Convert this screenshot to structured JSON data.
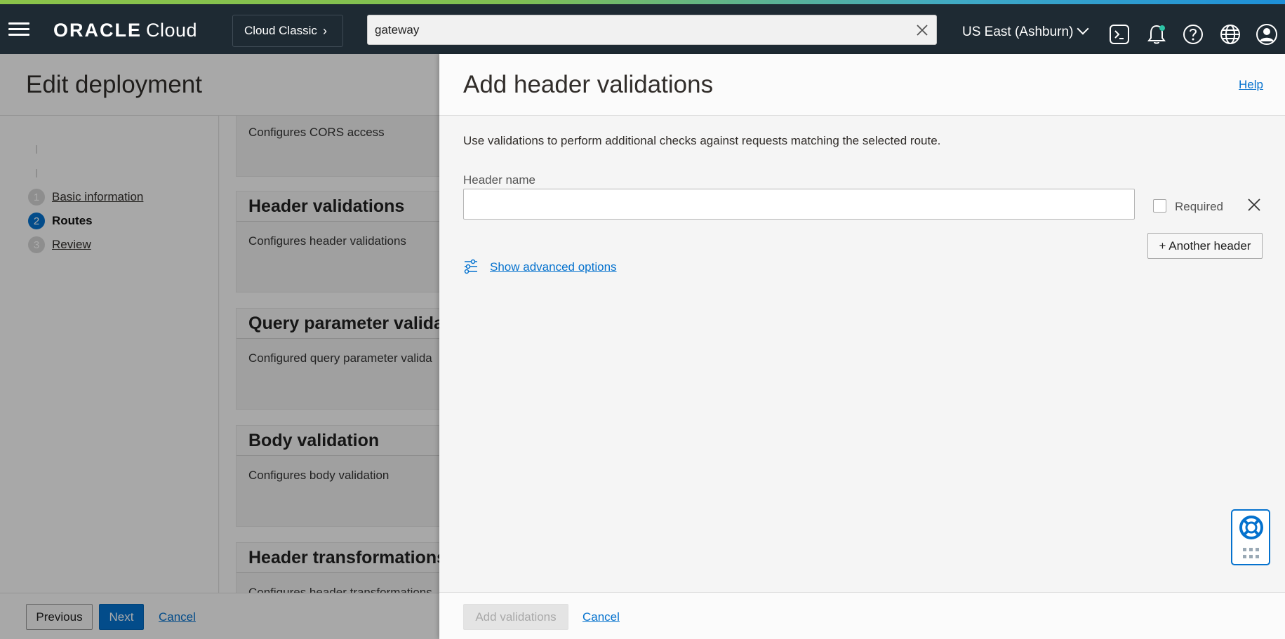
{
  "topbar": {
    "brand_oracle": "ORACLE",
    "brand_cloud": "Cloud",
    "classic_label": "Cloud Classic",
    "search_value": "gateway",
    "region_label": "US East (Ashburn)",
    "icons": [
      "menu-icon",
      "cloud-shell-icon",
      "bell-icon",
      "help-icon",
      "globe-icon",
      "profile-icon"
    ]
  },
  "left": {
    "title": "Edit deployment",
    "steps": [
      {
        "num": "1",
        "label": "Basic information"
      },
      {
        "num": "2",
        "label": "Routes"
      },
      {
        "num": "3",
        "label": "Review"
      }
    ],
    "cards": [
      {
        "title": "",
        "desc": "Configures CORS access"
      },
      {
        "title": "Header validations",
        "desc": "Configures header validations"
      },
      {
        "title": "Query parameter valida",
        "desc": "Configured query parameter valida"
      },
      {
        "title": "Body validation",
        "desc": "Configures body validation"
      },
      {
        "title": "Header transformations",
        "desc": "Configures header transformations"
      }
    ],
    "previous_label": "Previous",
    "next_label": "Next",
    "cancel_label": "Cancel"
  },
  "panel": {
    "title": "Add header validations",
    "help_label": "Help",
    "intro": "Use validations to perform additional checks against requests matching the selected route.",
    "header_name_label": "Header name",
    "header_name_value": "",
    "required_label": "Required",
    "another_header_label": "+ Another header",
    "advanced_label": "Show advanced options",
    "add_validations_label": "Add validations",
    "cancel_label": "Cancel"
  },
  "colors": {
    "accent": "#0572ce",
    "topbar": "#1e2a33"
  }
}
